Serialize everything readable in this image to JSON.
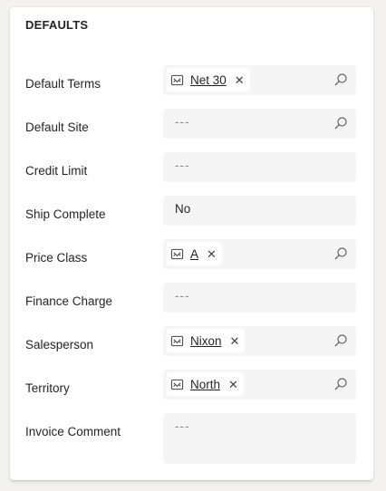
{
  "section": {
    "title": "DEFAULTS"
  },
  "fields": {
    "default_terms": {
      "label": "Default Terms",
      "value": "Net 30"
    },
    "default_site": {
      "label": "Default Site",
      "value": "---"
    },
    "credit_limit": {
      "label": "Credit Limit",
      "value": "---"
    },
    "ship_complete": {
      "label": "Ship Complete",
      "value": "No"
    },
    "price_class": {
      "label": "Price Class",
      "value": "A"
    },
    "finance_charge": {
      "label": "Finance Charge",
      "value": "---"
    },
    "salesperson": {
      "label": "Salesperson",
      "value": "Nixon"
    },
    "territory": {
      "label": "Territory",
      "value": "North"
    },
    "invoice_comment": {
      "label": "Invoice Comment",
      "value": "---"
    }
  },
  "icons": {
    "lookup_tag": "record-icon",
    "search": "search-icon",
    "remove": "close-icon"
  },
  "colors": {
    "field_bg": "#f5f5f5",
    "text": "#242424",
    "placeholder": "#8a8a8a"
  }
}
